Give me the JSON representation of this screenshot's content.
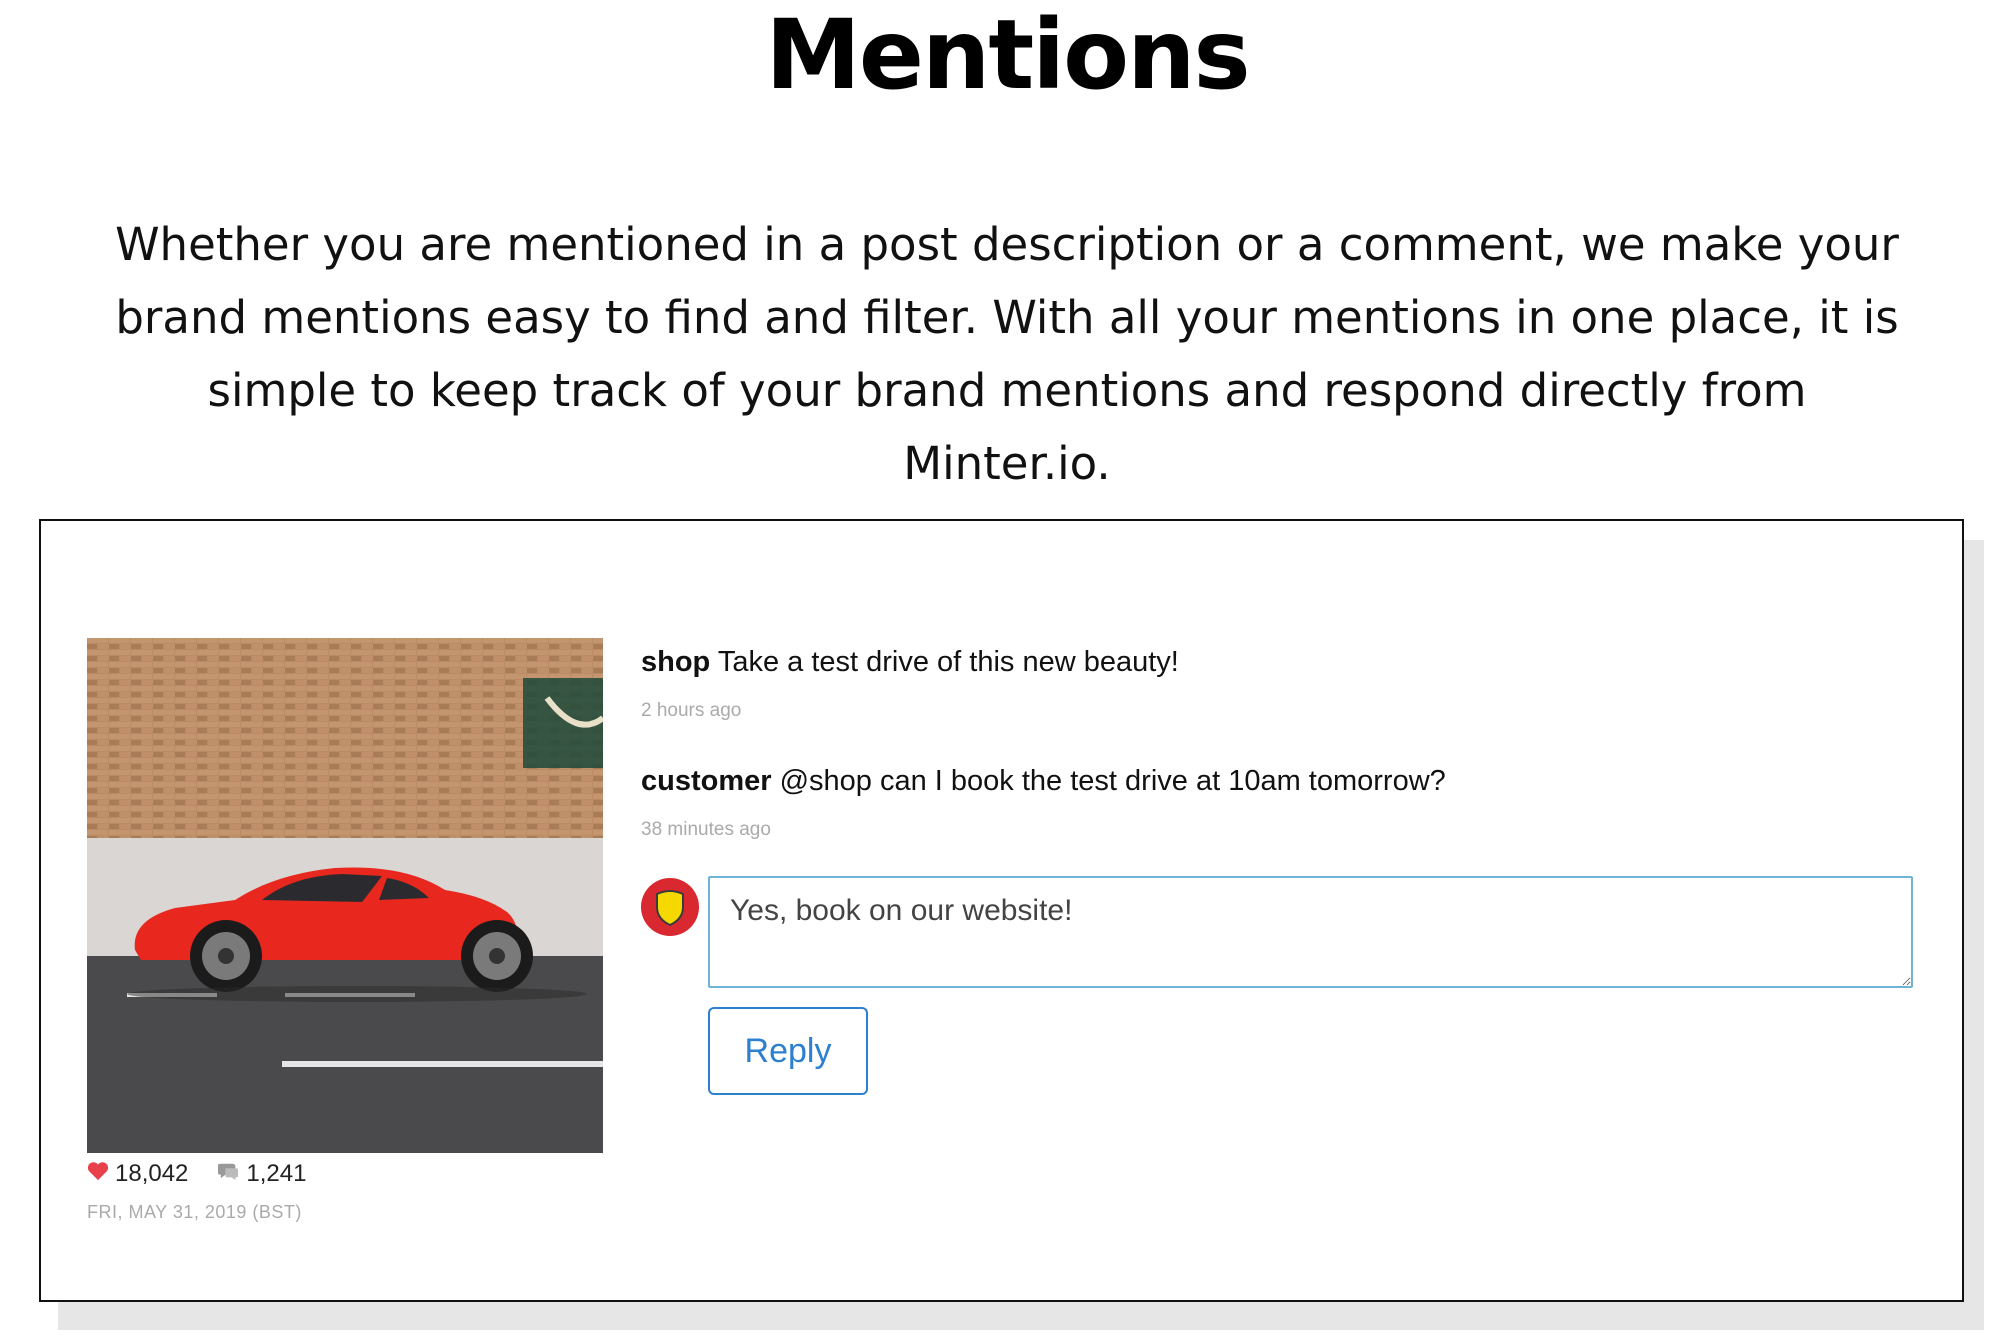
{
  "page": {
    "title": "Mentions",
    "intro": "Whether you are mentioned in a post description or a comment, we make your brand mentions easy to find and filter. With all your mentions in one place, it is simple to keep track of your brand mentions and respond directly from Minter.io."
  },
  "post": {
    "likes": "18,042",
    "comments_count": "1,241",
    "date": "FRI, MAY 31, 2019 (BST)"
  },
  "comments": [
    {
      "user": "shop",
      "text": "Take a test drive of this new beauty!",
      "time": "2 hours ago"
    },
    {
      "user": "customer",
      "text": "@shop can I book the test drive at 10am tomorrow?",
      "time": "38 minutes ago"
    }
  ],
  "reply": {
    "value": "Yes, book on our website!",
    "button_label": "Reply"
  },
  "icons": {
    "like": "heart-icon",
    "comments": "comment-bubble-icon",
    "avatar": "shield-icon"
  },
  "colors": {
    "accent": "#2c80cf",
    "input_border": "#6fb3d6",
    "heart": "#e8414b",
    "avatar_red": "#d9282f",
    "avatar_yellow": "#f5d800"
  }
}
